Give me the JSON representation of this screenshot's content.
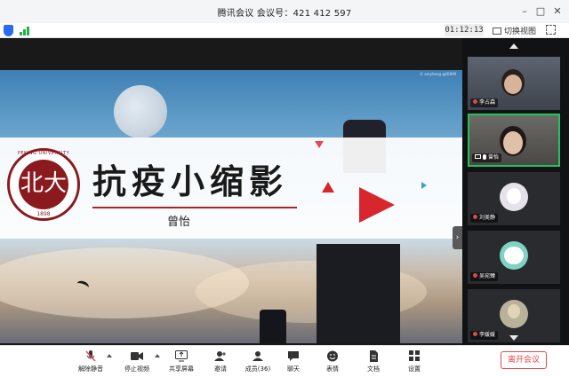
{
  "window": {
    "title": "腾讯会议 会议号：421 412 597",
    "minimize_glyph": "–",
    "maximize_glyph": "□",
    "close_glyph": "✕"
  },
  "status": {
    "timer": "01:12:13",
    "switch_view_label": "切换视图",
    "icons": [
      "shield-icon",
      "signal-icon",
      "fullscreen-icon"
    ]
  },
  "slide": {
    "credit": "© amyhong @IDIAM",
    "logo_top_text": "PEKING UNIVERSITY",
    "logo_glyph": "北大",
    "logo_year": "1898",
    "title": "抗疫小缩影",
    "author": "曾怡"
  },
  "participants": [
    {
      "name": "李占森",
      "type": "video"
    },
    {
      "name": "曾怡",
      "type": "video"
    },
    {
      "name": "刘美静",
      "type": "avatar"
    },
    {
      "name": "吴宛臻",
      "type": "avatar"
    },
    {
      "name": "李媛媛",
      "type": "avatar"
    }
  ],
  "toolbar": {
    "unmute": "解除静音",
    "stop_video": "停止视频",
    "share_screen": "共享屏幕",
    "invite": "邀请",
    "members": "成员(36)",
    "chat": "聊天",
    "reactions": "表情",
    "docs": "文档",
    "settings": "设置",
    "leave": "离开会议"
  },
  "colors": {
    "accent_red": "#e5484d",
    "active_speaker": "#24c25a",
    "logo_red": "#8b1a1f"
  }
}
